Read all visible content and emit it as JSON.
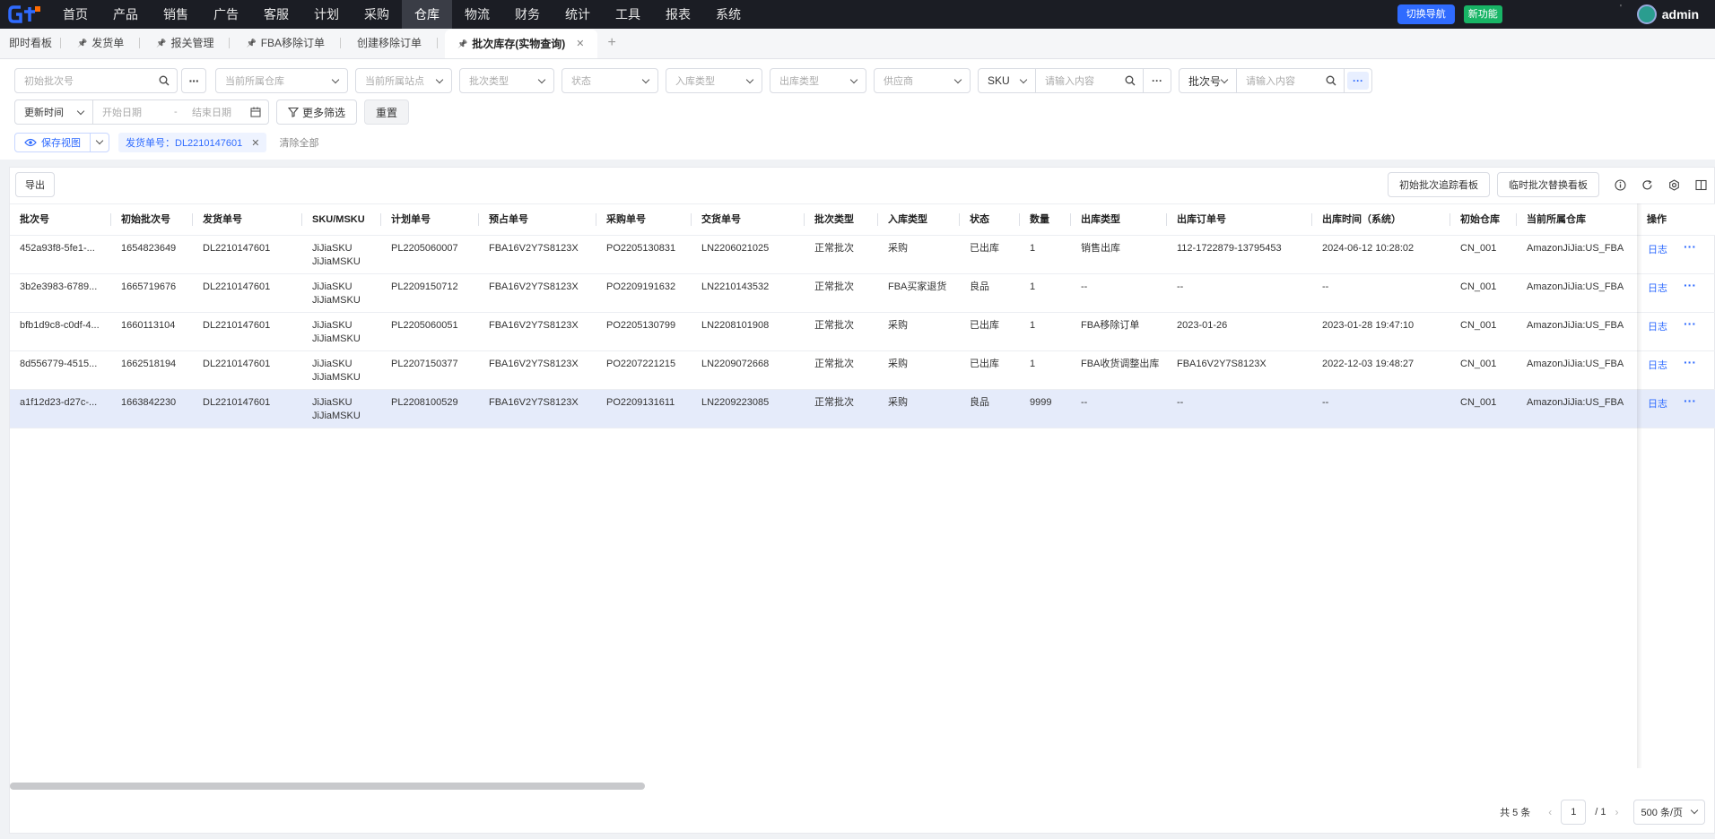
{
  "nav": {
    "menu": [
      "首页",
      "产品",
      "销售",
      "广告",
      "客服",
      "计划",
      "采购",
      "仓库",
      "物流",
      "财务",
      "统计",
      "工具",
      "报表",
      "系统"
    ],
    "active_index": 7,
    "switch_label": "切换导航",
    "new_feature": "新功能",
    "tick": "'",
    "username": "admin"
  },
  "tabs": {
    "items": [
      {
        "label": "即时看板",
        "pin": false
      },
      {
        "label": "发货单",
        "pin": true
      },
      {
        "label": "报关管理",
        "pin": true
      },
      {
        "label": "FBA移除订单",
        "pin": true
      },
      {
        "label": "创建移除订单",
        "pin": false
      },
      {
        "label": "批次库存(实物查询)",
        "pin": true,
        "active": true
      }
    ],
    "add": "+"
  },
  "filters": {
    "initial_batch": "初始批次号",
    "warehouse": "当前所属仓库",
    "site": "当前所属站点",
    "batch_type": "批次类型",
    "status": "状态",
    "inbound_type": "入库类型",
    "outbound_type": "出库类型",
    "supplier": "供应商",
    "sku_selector": "SKU",
    "sku_placeholder": "请输入内容",
    "batch_selector": "批次号",
    "batch_placeholder": "请输入内容",
    "time_selector": "更新时间",
    "start_date": "开始日期",
    "date_sep": "-",
    "end_date": "结束日期",
    "more_filter": "更多筛选",
    "reset": "重置",
    "save_view": "保存视图",
    "active_tag": "发货单号：DL2210147601",
    "clear_all": "清除全部",
    "dots": "···"
  },
  "toolbar": {
    "export": "导出",
    "board1": "初始批次追踪看板",
    "board2": "临时批次替换看板"
  },
  "table": {
    "columns": [
      "批次号",
      "初始批次号",
      "发货单号",
      "SKU/MSKU",
      "计划单号",
      "预占单号",
      "采购单号",
      "交货单号",
      "批次类型",
      "入库类型",
      "状态",
      "数量",
      "出库类型",
      "出库订单号",
      "出库时间（系统）",
      "初始仓库",
      "当前所属仓库",
      "操作"
    ],
    "rows": [
      {
        "batch": "452a93f8-5fe1-...",
        "init": "1654823649",
        "ship": "DL2210147601",
        "sku": "JiJiaSKU",
        "msku": "JiJiaMSKU",
        "plan": "PL2205060007",
        "pre": "FBA16V2Y7S8123X",
        "po": "PO2205130831",
        "ln": "LN2206021025",
        "btype": "正常批次",
        "itype": "采购",
        "status": "已出库",
        "qty": "1",
        "otype": "销售出库",
        "oorder": "112-1722879-13795453",
        "otime": "2024-06-12 10:28:02",
        "iwh": "CN_001",
        "cwh": "AmazonJiJia:US_FBA",
        "log": "日志"
      },
      {
        "batch": "3b2e3983-6789...",
        "init": "1665719676",
        "ship": "DL2210147601",
        "sku": "JiJiaSKU",
        "msku": "JiJiaMSKU",
        "plan": "PL2209150712",
        "pre": "FBA16V2Y7S8123X",
        "po": "PO2209191632",
        "ln": "LN2210143532",
        "btype": "正常批次",
        "itype": "FBA买家退货",
        "status": "良品",
        "qty": "1",
        "otype": "--",
        "oorder": "--",
        "otime": "--",
        "iwh": "CN_001",
        "cwh": "AmazonJiJia:US_FBA",
        "log": "日志"
      },
      {
        "batch": "bfb1d9c8-c0df-4...",
        "init": "1660113104",
        "ship": "DL2210147601",
        "sku": "JiJiaSKU",
        "msku": "JiJiaMSKU",
        "plan": "PL2205060051",
        "pre": "FBA16V2Y7S8123X",
        "po": "PO2205130799",
        "ln": "LN2208101908",
        "btype": "正常批次",
        "itype": "采购",
        "status": "已出库",
        "qty": "1",
        "otype": "FBA移除订单",
        "oorder": "2023-01-26",
        "otime": "2023-01-28 19:47:10",
        "iwh": "CN_001",
        "cwh": "AmazonJiJia:US_FBA",
        "log": "日志"
      },
      {
        "batch": "8d556779-4515...",
        "init": "1662518194",
        "ship": "DL2210147601",
        "sku": "JiJiaSKU",
        "msku": "JiJiaMSKU",
        "plan": "PL2207150377",
        "pre": "FBA16V2Y7S8123X",
        "po": "PO2207221215",
        "ln": "LN2209072668",
        "btype": "正常批次",
        "itype": "采购",
        "status": "已出库",
        "qty": "1",
        "otype": "FBA收货调整出库",
        "oorder": "FBA16V2Y7S8123X",
        "otime": "2022-12-03 19:48:27",
        "iwh": "CN_001",
        "cwh": "AmazonJiJia:US_FBA",
        "log": "日志"
      },
      {
        "batch": "a1f12d23-d27c-...",
        "init": "1663842230",
        "ship": "DL2210147601",
        "sku": "JiJiaSKU",
        "msku": "JiJiaMSKU",
        "plan": "PL2208100529",
        "pre": "FBA16V2Y7S8123X",
        "po": "PO2209131611",
        "ln": "LN2209223085",
        "btype": "正常批次",
        "itype": "采购",
        "status": "良品",
        "qty": "9999",
        "otype": "--",
        "oorder": "--",
        "otime": "--",
        "iwh": "CN_001",
        "cwh": "AmazonJiJia:US_FBA",
        "log": "日志"
      }
    ],
    "selected_row": 4
  },
  "pager": {
    "total": "共 5 条",
    "prev": "‹",
    "current": "1",
    "sep": "/ 1",
    "next": "›",
    "size": "500 条/页"
  },
  "colors": {
    "accent": "#2f6bff",
    "nav_bg": "#1b1d24",
    "new_feature": "#18b566"
  }
}
